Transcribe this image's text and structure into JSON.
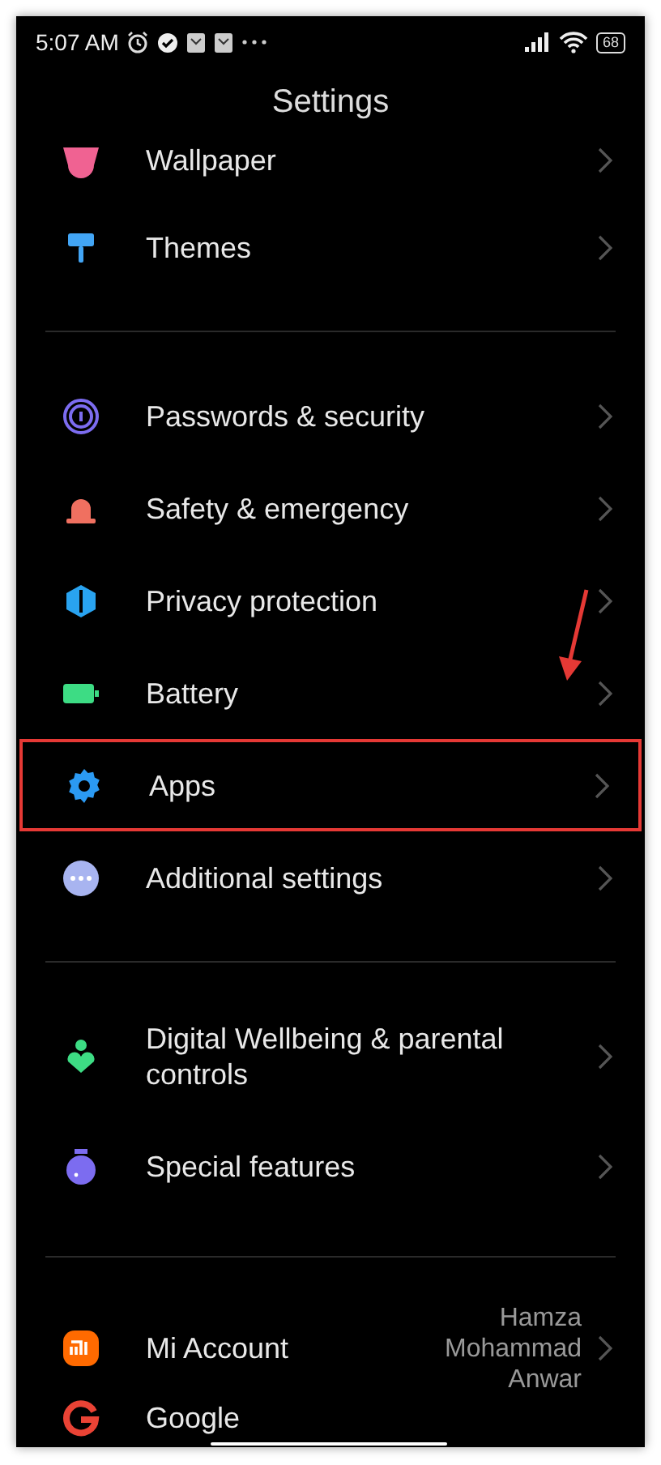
{
  "status_bar": {
    "time": "5:07 AM",
    "battery": "68"
  },
  "title": "Settings",
  "groups": [
    {
      "items": [
        {
          "label": "Wallpaper",
          "highlighted": false
        },
        {
          "label": "Themes",
          "highlighted": false
        }
      ]
    },
    {
      "items": [
        {
          "label": "Passwords & security",
          "highlighted": false
        },
        {
          "label": "Safety & emergency",
          "highlighted": false
        },
        {
          "label": "Privacy protection",
          "highlighted": false
        },
        {
          "label": "Battery",
          "highlighted": false
        },
        {
          "label": "Apps",
          "highlighted": true
        },
        {
          "label": "Additional settings",
          "highlighted": false
        }
      ]
    },
    {
      "items": [
        {
          "label": "Digital Wellbeing & parental controls",
          "highlighted": false
        },
        {
          "label": "Special features",
          "highlighted": false
        }
      ]
    },
    {
      "items": [
        {
          "label": "Mi Account",
          "value": "Hamza Mohammad Anwar",
          "highlighted": false
        },
        {
          "label": "Google",
          "highlighted": false
        }
      ]
    }
  ]
}
